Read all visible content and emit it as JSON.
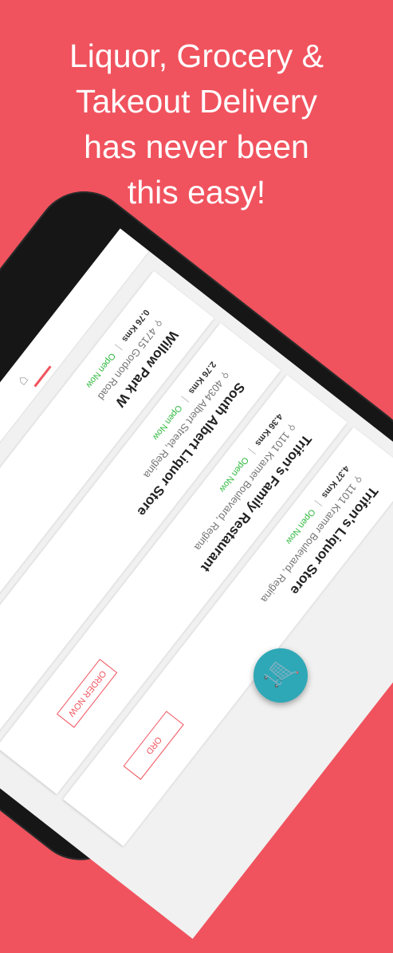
{
  "headline": {
    "line1": "Liquor, Grocery &",
    "line2": "Takeout Delivery",
    "line3": "has never been",
    "line4": "this easy!"
  },
  "icons": {
    "store": "store-icon",
    "pin": "map-pin-icon",
    "cart": "cart-icon",
    "pin_glyph": "⚲",
    "store_glyph": "⌂",
    "cart_glyph": "🛒"
  },
  "colors": {
    "background": "#f0535e",
    "accent_red": "#f0535e",
    "open_green": "#2db83d",
    "fab_teal": "#2ea8b7"
  },
  "stores": [
    {
      "name": "Willow Park W",
      "address": "4715 Gordon Road",
      "distance": "0.76 Kms",
      "status": "Open Now",
      "order_label": ""
    },
    {
      "name": "South Albert Liquor Store",
      "address": "4034 Albert Street, Regina",
      "distance": "2.76 Kms",
      "status": "Open Now",
      "order_label": ""
    },
    {
      "name": "Trifon's Family Restaurant",
      "address": "1101 Kramer Boulevard, Regina",
      "distance": "4.36 Kms",
      "status": "Open Now",
      "order_label": "ORDER NOW"
    },
    {
      "name": "Trifon's Liquor Store",
      "address": "1101 Kramer Boulevard, Regina",
      "distance": "4.37 Kms",
      "status": "Open Now",
      "order_label": "ORD"
    }
  ]
}
